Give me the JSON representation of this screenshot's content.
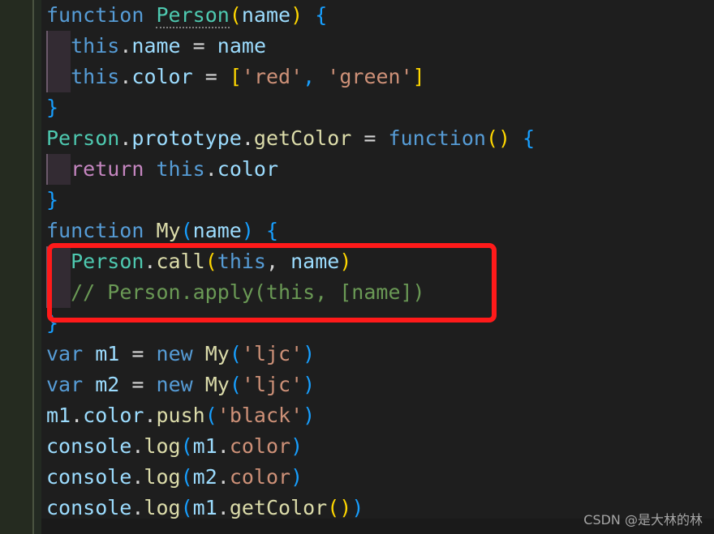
{
  "editor": {
    "language": "javascript",
    "theme": "dark-plus",
    "background_color": "#1e1e1e",
    "gutter_color": "#252b20",
    "indent_guide_color": "#332b33"
  },
  "annotation": {
    "type": "rectangle",
    "color": "#ff1a1a",
    "target_lines": [
      9,
      10
    ]
  },
  "watermark": {
    "text": "CSDN @是大林的林"
  },
  "lines": [
    {
      "n": 1,
      "text": "function Person(name) {",
      "tokens": [
        {
          "t": "function",
          "c": "kw"
        },
        {
          "t": " ",
          "c": "punct"
        },
        {
          "t": "Person",
          "c": "fn-green squiggle"
        },
        {
          "t": "(",
          "c": "paren-y"
        },
        {
          "t": "name",
          "c": "var-blue"
        },
        {
          "t": ")",
          "c": "paren-y"
        },
        {
          "t": " ",
          "c": "punct"
        },
        {
          "t": "{",
          "c": "paren-b"
        }
      ]
    },
    {
      "n": 2,
      "text": "  this.name = name",
      "tokens": [
        {
          "t": "  ",
          "c": "punct"
        },
        {
          "t": "this",
          "c": "this-blu"
        },
        {
          "t": ".",
          "c": "dot"
        },
        {
          "t": "name",
          "c": "var-blue"
        },
        {
          "t": " ",
          "c": "punct"
        },
        {
          "t": "=",
          "c": "op"
        },
        {
          "t": " ",
          "c": "punct"
        },
        {
          "t": "name",
          "c": "var-blue"
        }
      ]
    },
    {
      "n": 3,
      "text": "  this.color = ['red', 'green']",
      "tokens": [
        {
          "t": "  ",
          "c": "punct"
        },
        {
          "t": "this",
          "c": "this-blu"
        },
        {
          "t": ".",
          "c": "dot"
        },
        {
          "t": "color",
          "c": "var-blue"
        },
        {
          "t": " ",
          "c": "punct"
        },
        {
          "t": "=",
          "c": "op"
        },
        {
          "t": " ",
          "c": "punct"
        },
        {
          "t": "[",
          "c": "paren-y"
        },
        {
          "t": "'red'",
          "c": "str"
        },
        {
          "t": ",",
          "c": "paren-b"
        },
        {
          "t": " ",
          "c": "punct"
        },
        {
          "t": "'green'",
          "c": "str"
        },
        {
          "t": "]",
          "c": "paren-y"
        }
      ]
    },
    {
      "n": 4,
      "text": "}",
      "tokens": [
        {
          "t": "}",
          "c": "paren-b"
        }
      ]
    },
    {
      "n": 5,
      "text": "Person.prototype.getColor = function() {",
      "tokens": [
        {
          "t": "Person",
          "c": "fn-green"
        },
        {
          "t": ".",
          "c": "dot"
        },
        {
          "t": "prototype",
          "c": "var-blue"
        },
        {
          "t": ".",
          "c": "dot"
        },
        {
          "t": "getColor",
          "c": "fn-yel"
        },
        {
          "t": " ",
          "c": "punct"
        },
        {
          "t": "=",
          "c": "op"
        },
        {
          "t": " ",
          "c": "punct"
        },
        {
          "t": "function",
          "c": "kw"
        },
        {
          "t": "(",
          "c": "paren-y"
        },
        {
          "t": ")",
          "c": "paren-y"
        },
        {
          "t": " ",
          "c": "punct"
        },
        {
          "t": "{",
          "c": "paren-b"
        }
      ]
    },
    {
      "n": 6,
      "text": "  return this.color",
      "tokens": [
        {
          "t": "  ",
          "c": "punct"
        },
        {
          "t": "return",
          "c": "kw-pink"
        },
        {
          "t": " ",
          "c": "punct"
        },
        {
          "t": "this",
          "c": "this-blu"
        },
        {
          "t": ".",
          "c": "dot"
        },
        {
          "t": "color",
          "c": "var-blue"
        }
      ]
    },
    {
      "n": 7,
      "text": "}",
      "tokens": [
        {
          "t": "}",
          "c": "paren-b"
        }
      ]
    },
    {
      "n": 8,
      "text": "function My(name) {",
      "tokens": [
        {
          "t": "function",
          "c": "kw"
        },
        {
          "t": " ",
          "c": "punct"
        },
        {
          "t": "My",
          "c": "fn-yel"
        },
        {
          "t": "(",
          "c": "paren-b"
        },
        {
          "t": "name",
          "c": "var-blue"
        },
        {
          "t": ")",
          "c": "paren-b"
        },
        {
          "t": " ",
          "c": "punct"
        },
        {
          "t": "{",
          "c": "paren-b"
        }
      ]
    },
    {
      "n": 9,
      "text": "  Person.call(this, name)",
      "tokens": [
        {
          "t": "  ",
          "c": "punct"
        },
        {
          "t": "Person",
          "c": "fn-green"
        },
        {
          "t": ".",
          "c": "dot"
        },
        {
          "t": "call",
          "c": "fn-yel"
        },
        {
          "t": "(",
          "c": "paren-y"
        },
        {
          "t": "this",
          "c": "this-blu"
        },
        {
          "t": ",",
          "c": "punct"
        },
        {
          "t": " ",
          "c": "punct"
        },
        {
          "t": "name",
          "c": "var-blue"
        },
        {
          "t": ")",
          "c": "paren-y"
        }
      ]
    },
    {
      "n": 10,
      "text": "  // Person.apply(this, [name])",
      "tokens": [
        {
          "t": "  ",
          "c": "punct"
        },
        {
          "t": "// Person.apply(this, [name])",
          "c": "comment"
        }
      ]
    },
    {
      "n": 11,
      "text": "}",
      "tokens": [
        {
          "t": "}",
          "c": "paren-b"
        }
      ]
    },
    {
      "n": 12,
      "text": "var m1 = new My('ljc')",
      "tokens": [
        {
          "t": "var",
          "c": "kw"
        },
        {
          "t": " ",
          "c": "punct"
        },
        {
          "t": "m1",
          "c": "var-blue"
        },
        {
          "t": " ",
          "c": "punct"
        },
        {
          "t": "=",
          "c": "op"
        },
        {
          "t": " ",
          "c": "punct"
        },
        {
          "t": "new",
          "c": "kw"
        },
        {
          "t": " ",
          "c": "punct"
        },
        {
          "t": "My",
          "c": "fn-yel"
        },
        {
          "t": "(",
          "c": "paren-b"
        },
        {
          "t": "'ljc'",
          "c": "str"
        },
        {
          "t": ")",
          "c": "paren-b"
        }
      ]
    },
    {
      "n": 13,
      "text": "var m2 = new My('ljc')",
      "tokens": [
        {
          "t": "var",
          "c": "kw"
        },
        {
          "t": " ",
          "c": "punct"
        },
        {
          "t": "m2",
          "c": "var-blue"
        },
        {
          "t": " ",
          "c": "punct"
        },
        {
          "t": "=",
          "c": "op"
        },
        {
          "t": " ",
          "c": "punct"
        },
        {
          "t": "new",
          "c": "kw"
        },
        {
          "t": " ",
          "c": "punct"
        },
        {
          "t": "My",
          "c": "fn-yel"
        },
        {
          "t": "(",
          "c": "paren-b"
        },
        {
          "t": "'ljc'",
          "c": "str"
        },
        {
          "t": ")",
          "c": "paren-b"
        }
      ]
    },
    {
      "n": 14,
      "text": "m1.color.push('black')",
      "tokens": [
        {
          "t": "m1",
          "c": "var-blue"
        },
        {
          "t": ".",
          "c": "dot"
        },
        {
          "t": "color",
          "c": "var-blue"
        },
        {
          "t": ".",
          "c": "dot"
        },
        {
          "t": "push",
          "c": "fn-yel"
        },
        {
          "t": "(",
          "c": "paren-b"
        },
        {
          "t": "'black'",
          "c": "str"
        },
        {
          "t": ")",
          "c": "paren-b"
        }
      ]
    },
    {
      "n": 15,
      "text": "console.log(m1.color)",
      "tokens": [
        {
          "t": "console",
          "c": "var-blue"
        },
        {
          "t": ".",
          "c": "dot"
        },
        {
          "t": "log",
          "c": "fn-yel"
        },
        {
          "t": "(",
          "c": "paren-b"
        },
        {
          "t": "m1",
          "c": "var-blue"
        },
        {
          "t": ".",
          "c": "dot"
        },
        {
          "t": "color",
          "c": "str"
        },
        {
          "t": ")",
          "c": "paren-b"
        }
      ]
    },
    {
      "n": 16,
      "text": "console.log(m2.color)",
      "tokens": [
        {
          "t": "console",
          "c": "var-blue"
        },
        {
          "t": ".",
          "c": "dot"
        },
        {
          "t": "log",
          "c": "fn-yel"
        },
        {
          "t": "(",
          "c": "paren-b"
        },
        {
          "t": "m2",
          "c": "var-blue"
        },
        {
          "t": ".",
          "c": "dot"
        },
        {
          "t": "color",
          "c": "str"
        },
        {
          "t": ")",
          "c": "paren-b"
        }
      ]
    },
    {
      "n": 17,
      "text": "console.log(m1.getColor())",
      "tokens": [
        {
          "t": "console",
          "c": "var-blue"
        },
        {
          "t": ".",
          "c": "dot"
        },
        {
          "t": "log",
          "c": "fn-yel"
        },
        {
          "t": "(",
          "c": "paren-b"
        },
        {
          "t": "m1",
          "c": "var-blue"
        },
        {
          "t": ".",
          "c": "dot"
        },
        {
          "t": "getColor",
          "c": "fn-yel"
        },
        {
          "t": "(",
          "c": "paren-y"
        },
        {
          "t": ")",
          "c": "paren-y"
        },
        {
          "t": ")",
          "c": "paren-b"
        }
      ]
    }
  ]
}
